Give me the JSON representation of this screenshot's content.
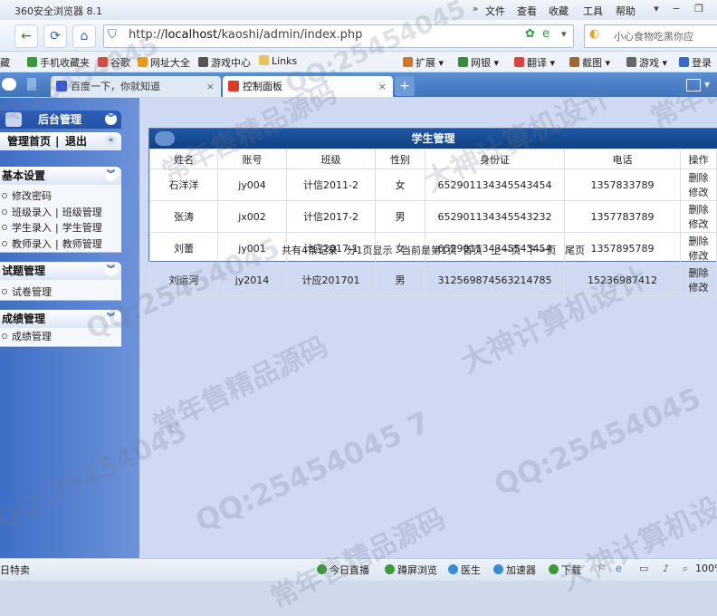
{
  "browser": {
    "title": "360安全浏览器 8.1",
    "menus": [
      "文件",
      "查看",
      "收藏",
      "工具",
      "帮助"
    ],
    "url_prefix": "http://",
    "url_host": "localhost",
    "url_path": "/kaoshi/admin/index.php",
    "search_placeholder": "小心食物吃黑你应",
    "bookmarks": [
      {
        "label": "手机收藏夹",
        "color": "#3a9a3a"
      },
      {
        "label": "谷歌",
        "color": "#d94a3a"
      },
      {
        "label": "网址大全",
        "color": "#e39c1c"
      },
      {
        "label": "游戏中心",
        "color": "#555555"
      },
      {
        "label": "Links",
        "color": "#e9c25a"
      }
    ],
    "tools": [
      {
        "label": "扩展",
        "color": "#d9732a"
      },
      {
        "label": "网银",
        "color": "#3a8c3a"
      },
      {
        "label": "翻译",
        "color": "#d9453a"
      },
      {
        "label": "截图",
        "color": "#a06a2a"
      },
      {
        "label": "游戏",
        "color": "#666666"
      },
      {
        "label": "登录",
        "color": "#3a6ac9"
      }
    ],
    "tabs": [
      {
        "label": "百度一下，你就知道",
        "close": "×",
        "color": "#3559d1"
      },
      {
        "label": "控制面板",
        "close": "×",
        "color": "#d93b2b"
      }
    ],
    "newtab": "+"
  },
  "sidebar": {
    "header": "后台管理",
    "home": "管理首页",
    "logout": "退出",
    "sections": [
      {
        "title": "基本设置",
        "items": [
          [
            "修改密码"
          ],
          [
            "班级录入",
            "班级管理"
          ],
          [
            "学生录入",
            "学生管理"
          ],
          [
            "教师录入",
            "教师管理"
          ]
        ]
      },
      {
        "title": "试题管理",
        "items": [
          [
            "试卷管理"
          ]
        ]
      },
      {
        "title": "成绩管理",
        "items": [
          [
            "成绩管理"
          ]
        ]
      }
    ]
  },
  "table": {
    "title": "学生管理",
    "columns": [
      "姓名",
      "账号",
      "班级",
      "性别",
      "身份证",
      "电话",
      "操作"
    ],
    "rows": [
      [
        "石洋洋",
        "jy004",
        "计信2011-2",
        "女",
        "652901134345543454",
        "1357833789"
      ],
      [
        "张涛",
        "jx002",
        "计信2017-2",
        "男",
        "652901134345543232",
        "1357783789"
      ],
      [
        "刘蕾",
        "jy001",
        "计应2017-1",
        "女",
        "652901134345543454",
        "1357895789"
      ],
      [
        "刘运河",
        "jy2014",
        "计应201701",
        "男",
        "312569874563214785",
        "15236987412"
      ]
    ],
    "op_delete": "删除",
    "op_edit": "修改",
    "pager": {
      "total": "共有4条记录",
      "pages": "分1页显示",
      "current": "当前是第1页",
      "first": "首页",
      "prev": "上一页",
      "next": "下一页",
      "last": "尾页"
    }
  },
  "status": {
    "left": "日特卖",
    "items": [
      {
        "label": "今日直播",
        "color": "#3a9a3a"
      },
      {
        "label": "蹲屏浏览",
        "color": "#3a9a3a"
      },
      {
        "label": "医生",
        "color": "#3a8cd0"
      },
      {
        "label": "加速器",
        "color": "#3a8cd0"
      },
      {
        "label": "下载",
        "color": "#3a9a3a"
      }
    ],
    "zoom": "100%"
  },
  "watermarks": {
    "qq": "QQ:25454045",
    "qq_full": "QQ:25454045 7",
    "dashen": "大神计算机设计",
    "changnian": "常年售精品源码"
  }
}
